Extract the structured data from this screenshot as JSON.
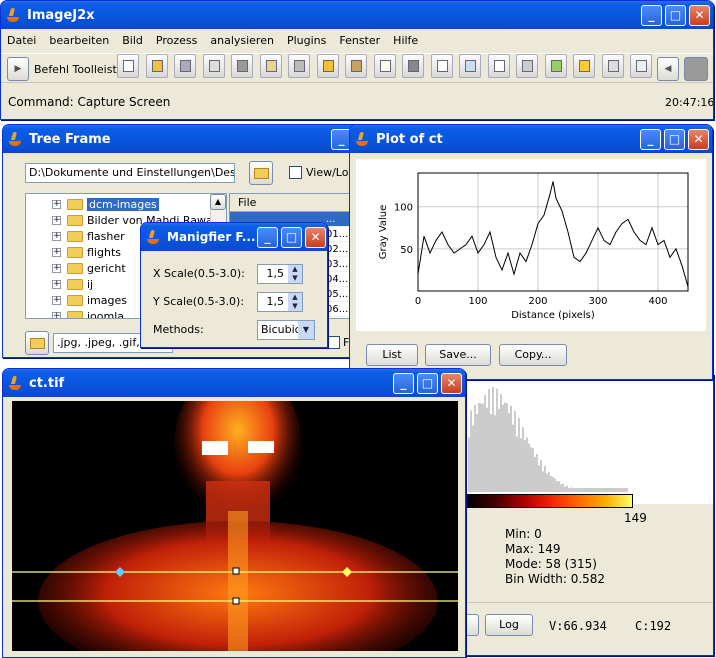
{
  "main": {
    "title": "ImageJ2x",
    "menu": [
      "Datei",
      "bearbeiten",
      "Bild",
      "Prozess",
      "analysieren",
      "Plugins",
      "Fenster",
      "Hilfe"
    ],
    "toolbar_label": "Befehl Toolleiste",
    "status": "Command: Capture Screen",
    "time": "20:47:16"
  },
  "tree_frame": {
    "title": "Tree Frame",
    "path": "D:\\Dokumente und Einstellungen\\Desktop\\",
    "view_load_label": "View/Load",
    "folders": [
      "dcm-images",
      "Bilder von Mahdi Rawak",
      "flasher",
      "flights",
      "gericht",
      "ij",
      "images",
      "joomla"
    ],
    "file_col": "File",
    "file_rows": [
      "...",
      "01...",
      "02...",
      "03...",
      "04...",
      "05...",
      "06..."
    ],
    "filter": ".jpg, .jpeg, .gif, .t",
    "fi_label": "Fi"
  },
  "magnifier": {
    "title": "Manigfier F...",
    "xscale_label": "X Scale(0.5-3.0):",
    "xscale_value": "1,5",
    "yscale_label": "Y Scale(0.5-3.0):",
    "yscale_value": "1,5",
    "methods_label": "Methods:",
    "method_value": "Bicubic"
  },
  "plot": {
    "title": "Plot of ct",
    "buttons": [
      "List",
      "Save...",
      "Copy..."
    ],
    "chart_data": {
      "type": "line",
      "xlabel": "Distance (pixels)",
      "ylabel": "Gray Value",
      "xlim": [
        0,
        450
      ],
      "ylim": [
        0,
        140
      ],
      "xticks": [
        0,
        100,
        200,
        300,
        400
      ],
      "yticks": [
        50,
        100
      ],
      "grid": true,
      "x": [
        0,
        10,
        20,
        30,
        40,
        50,
        60,
        70,
        80,
        90,
        100,
        110,
        120,
        130,
        140,
        150,
        160,
        170,
        180,
        190,
        200,
        210,
        220,
        225,
        230,
        240,
        250,
        260,
        270,
        280,
        290,
        300,
        310,
        320,
        330,
        340,
        350,
        360,
        370,
        380,
        390,
        400,
        410,
        420,
        430,
        440,
        450
      ],
      "y": [
        20,
        65,
        45,
        60,
        70,
        55,
        45,
        50,
        55,
        65,
        45,
        55,
        70,
        40,
        25,
        45,
        20,
        45,
        35,
        55,
        80,
        90,
        115,
        130,
        110,
        95,
        70,
        40,
        35,
        45,
        60,
        75,
        60,
        55,
        70,
        80,
        85,
        70,
        60,
        55,
        75,
        55,
        60,
        40,
        50,
        30,
        5
      ]
    }
  },
  "histogram": {
    "scale_max": "149",
    "stats": [
      "Min: 0",
      "Max: 149",
      "Mode: 58 (315)",
      "Bin Width: 0.582"
    ],
    "log_button": "Log",
    "value": "V:66.934",
    "count": "C:192"
  },
  "ct": {
    "title": "ct.tif"
  }
}
